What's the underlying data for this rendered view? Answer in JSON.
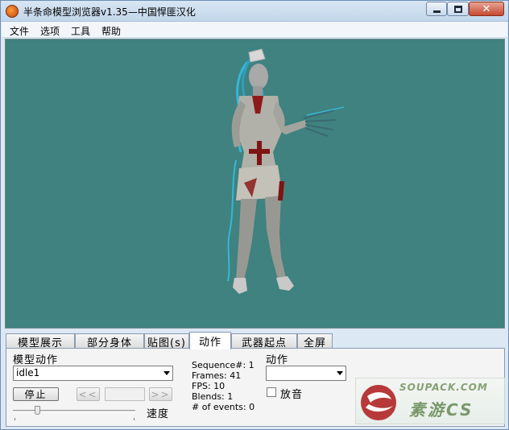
{
  "window": {
    "title": "半条命模型浏览器v1.35—中国悍匪汉化"
  },
  "titlebar_buttons": {
    "close_glyph": "✕"
  },
  "menubar": {
    "items": [
      "文件",
      "选项",
      "工具",
      "帮助"
    ]
  },
  "tabs": [
    "模型展示",
    "部分身体",
    "贴图(s)",
    "动作",
    "武器起点",
    "全屏"
  ],
  "active_tab_index": 3,
  "animation_panel": {
    "sequence_label": "模型动作",
    "sequence_value": "idle1",
    "stop_button": "停止",
    "prev_button": "<<",
    "next_button": ">>",
    "speed_label": "速度",
    "speed_slider_fraction": 0.2
  },
  "stats": {
    "sequence": "Sequence#: 1",
    "frames": "Frames: 41",
    "fps": "FPS: 10",
    "blends": "Blends: 1",
    "events": "# of events: 0"
  },
  "events_panel": {
    "label": "动作",
    "dropdown_value": "",
    "play_sound_label": "放音",
    "play_sound_checked": false
  },
  "watermark": {
    "line1": "SOUPACK.COM",
    "line2": "素游CS"
  },
  "colors": {
    "viewport_background": "#3f827f",
    "window_frame": "#dce8f4"
  }
}
